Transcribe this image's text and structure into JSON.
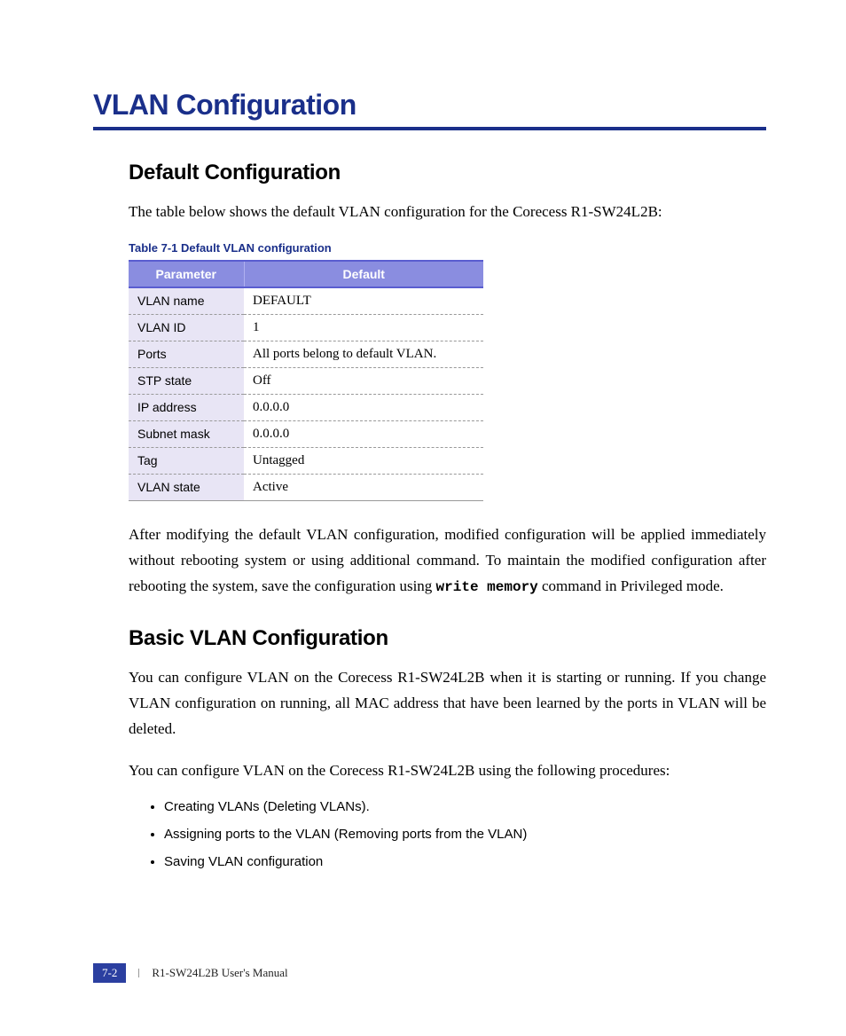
{
  "title": "VLAN Configuration",
  "section1": {
    "heading": "Default Configuration",
    "intro": "The table below shows the default VLAN configuration for the Corecess R1-SW24L2B:"
  },
  "table": {
    "caption": "Table 7-1   Default VLAN configuration",
    "head_param": "Parameter",
    "head_default": "Default",
    "rows": [
      {
        "param": "VLAN name",
        "val": "DEFAULT"
      },
      {
        "param": "VLAN ID",
        "val": "1"
      },
      {
        "param": "Ports",
        "val": "All ports belong to default VLAN."
      },
      {
        "param": "STP state",
        "val": "Off"
      },
      {
        "param": "IP address",
        "val": "0.0.0.0"
      },
      {
        "param": "Subnet mask",
        "val": "0.0.0.0"
      },
      {
        "param": "Tag",
        "val": "Untagged"
      },
      {
        "param": "VLAN state",
        "val": "Active"
      }
    ]
  },
  "after_table": {
    "para_pre": "After modifying the default VLAN configuration, modified configuration will be applied immediately without rebooting system or using additional command. To maintain the modified configuration after rebooting the system, save the configuration using ",
    "code": "write memory",
    "para_post": " command in Privileged mode."
  },
  "section2": {
    "heading": "Basic VLAN Configuration",
    "para1": "You can configure VLAN on the Corecess R1-SW24L2B when it is starting or running. If you change VLAN configuration on running, all MAC address that have been learned by the ports in VLAN will be deleted.",
    "para2": "You can configure VLAN on the Corecess R1-SW24L2B using the following procedures:",
    "items": [
      "Creating VLANs (Deleting VLANs).",
      "Assigning ports to the VLAN (Removing ports from the VLAN)",
      "Saving VLAN configuration"
    ]
  },
  "footer": {
    "page": "7-2",
    "doc": "R1-SW24L2B   User's Manual"
  }
}
